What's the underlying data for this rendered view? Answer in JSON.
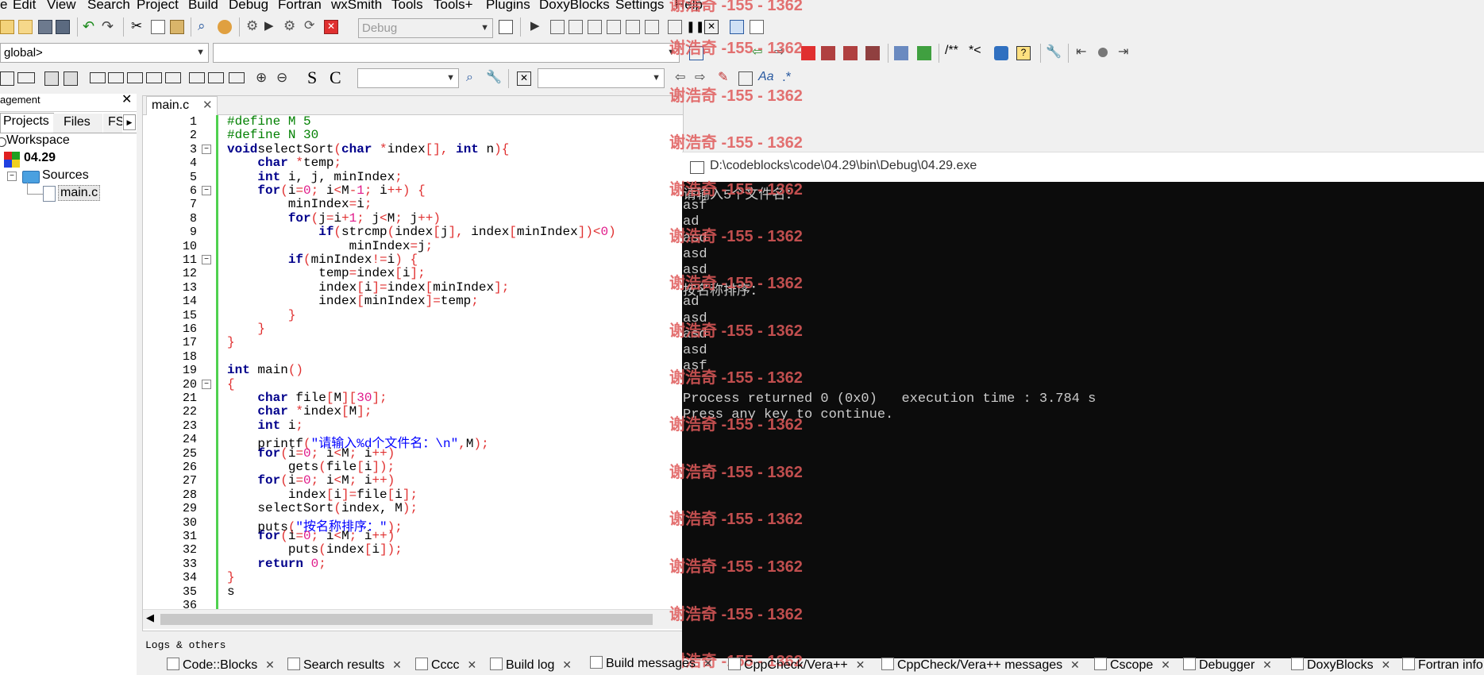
{
  "menu": [
    "e",
    "Edit",
    "View",
    "Search",
    "Project",
    "Build",
    "Debug",
    "Fortran",
    "wxSmith",
    "Tools",
    "Tools+",
    "Plugins",
    "DoxyBlocks",
    "Settings",
    "Help"
  ],
  "toolbar": {
    "build_target": "Debug",
    "scope": "global>",
    "comment_btn": "/**",
    "comment_btn2": "*<",
    "s_btn": "S",
    "c_btn": "C",
    "aa_btn": "Aa",
    "regex_btn": ".*"
  },
  "left_panel": {
    "title": "agement",
    "tabs": [
      "Projects",
      "Files",
      "FS"
    ],
    "tree": {
      "workspace": "Workspace",
      "project": "04.29",
      "folder": "Sources",
      "file": "main.c"
    }
  },
  "editor": {
    "tab": "main.c",
    "line_numbers": [
      "1",
      "2",
      "3",
      "4",
      "5",
      "6",
      "7",
      "8",
      "9",
      "10",
      "11",
      "12",
      "13",
      "14",
      "15",
      "16",
      "17",
      "18",
      "19",
      "20",
      "21",
      "22",
      "23",
      "24",
      "25",
      "26",
      "27",
      "28",
      "29",
      "30",
      "31",
      "32",
      "33",
      "34",
      "35",
      "36"
    ],
    "code": [
      [
        [
          "pp",
          "#define M 5"
        ]
      ],
      [
        [
          "pp",
          "#define N 30"
        ]
      ],
      [
        [
          "kw",
          "void"
        ],
        [
          "",
          "selectSort"
        ],
        [
          "op",
          "("
        ],
        [
          "kw",
          "char"
        ],
        [
          "",
          " "
        ],
        [
          "op",
          "*"
        ],
        [
          "",
          "index"
        ],
        [
          "op",
          "[],"
        ],
        [
          "",
          " "
        ],
        [
          "kw",
          "int"
        ],
        [
          "",
          " n"
        ],
        [
          "op",
          "){"
        ]
      ],
      [
        [
          "",
          "    "
        ],
        [
          "kw",
          "char"
        ],
        [
          "",
          " "
        ],
        [
          "op",
          "*"
        ],
        [
          "",
          "temp"
        ],
        [
          "op",
          ";"
        ]
      ],
      [
        [
          "",
          "    "
        ],
        [
          "kw",
          "int"
        ],
        [
          "",
          " i, j, minIndex"
        ],
        [
          "op",
          ";"
        ]
      ],
      [
        [
          "",
          "    "
        ],
        [
          "kw",
          "for"
        ],
        [
          "op",
          "("
        ],
        [
          "",
          "i"
        ],
        [
          "op",
          "="
        ],
        [
          "nm",
          "0"
        ],
        [
          "op",
          ";"
        ],
        [
          "",
          " i"
        ],
        [
          "op",
          "<"
        ],
        [
          "",
          "M"
        ],
        [
          "op",
          "-"
        ],
        [
          "nm",
          "1"
        ],
        [
          "op",
          ";"
        ],
        [
          "",
          " i"
        ],
        [
          "op",
          "++"
        ],
        [
          "op",
          ") {"
        ]
      ],
      [
        [
          "",
          "        minIndex"
        ],
        [
          "op",
          "="
        ],
        [
          "",
          "i"
        ],
        [
          "op",
          ";"
        ]
      ],
      [
        [
          "",
          "        "
        ],
        [
          "kw",
          "for"
        ],
        [
          "op",
          "("
        ],
        [
          "",
          "j"
        ],
        [
          "op",
          "="
        ],
        [
          "",
          "i"
        ],
        [
          "op",
          "+"
        ],
        [
          "nm",
          "1"
        ],
        [
          "op",
          ";"
        ],
        [
          "",
          " j"
        ],
        [
          "op",
          "<"
        ],
        [
          "",
          "M"
        ],
        [
          "op",
          ";"
        ],
        [
          "",
          " j"
        ],
        [
          "op",
          "++"
        ],
        [
          "op",
          ")"
        ]
      ],
      [
        [
          "",
          "            "
        ],
        [
          "kw",
          "if"
        ],
        [
          "op",
          "("
        ],
        [
          "",
          "strcmp"
        ],
        [
          "op",
          "("
        ],
        [
          "",
          "index"
        ],
        [
          "op",
          "["
        ],
        [
          "",
          "j"
        ],
        [
          "op",
          "],"
        ],
        [
          "",
          " index"
        ],
        [
          "op",
          "["
        ],
        [
          "",
          "minIndex"
        ],
        [
          "op",
          "])<"
        ],
        [
          "nm",
          "0"
        ],
        [
          "op",
          ")"
        ]
      ],
      [
        [
          "",
          "                minIndex"
        ],
        [
          "op",
          "="
        ],
        [
          "",
          "j"
        ],
        [
          "op",
          ";"
        ]
      ],
      [
        [
          "",
          "        "
        ],
        [
          "kw",
          "if"
        ],
        [
          "op",
          "("
        ],
        [
          "",
          "minIndex"
        ],
        [
          "op",
          "!="
        ],
        [
          "",
          "i"
        ],
        [
          "op",
          ") {"
        ]
      ],
      [
        [
          "",
          "            temp"
        ],
        [
          "op",
          "="
        ],
        [
          "",
          "index"
        ],
        [
          "op",
          "["
        ],
        [
          "",
          "i"
        ],
        [
          "op",
          "];"
        ]
      ],
      [
        [
          "",
          "            index"
        ],
        [
          "op",
          "["
        ],
        [
          "",
          "i"
        ],
        [
          "op",
          "]="
        ],
        [
          "",
          "index"
        ],
        [
          "op",
          "["
        ],
        [
          "",
          "minIndex"
        ],
        [
          "op",
          "];"
        ]
      ],
      [
        [
          "",
          "            index"
        ],
        [
          "op",
          "["
        ],
        [
          "",
          "minIndex"
        ],
        [
          "op",
          "]="
        ],
        [
          "",
          "temp"
        ],
        [
          "op",
          ";"
        ]
      ],
      [
        [
          "",
          "        "
        ],
        [
          "op",
          "}"
        ]
      ],
      [
        [
          "",
          "    "
        ],
        [
          "op",
          "}"
        ]
      ],
      [
        [
          "op",
          "}"
        ]
      ],
      [
        [
          "",
          ""
        ]
      ],
      [
        [
          "kw",
          "int"
        ],
        [
          "",
          " main"
        ],
        [
          "op",
          "()"
        ]
      ],
      [
        [
          "op",
          "{"
        ]
      ],
      [
        [
          "",
          "    "
        ],
        [
          "kw",
          "char"
        ],
        [
          "",
          " file"
        ],
        [
          "op",
          "["
        ],
        [
          "",
          "M"
        ],
        [
          "op",
          "]["
        ],
        [
          "nm",
          "30"
        ],
        [
          "op",
          "];"
        ]
      ],
      [
        [
          "",
          "    "
        ],
        [
          "kw",
          "char"
        ],
        [
          "",
          " "
        ],
        [
          "op",
          "*"
        ],
        [
          "",
          "index"
        ],
        [
          "op",
          "["
        ],
        [
          "",
          "M"
        ],
        [
          "op",
          "];"
        ]
      ],
      [
        [
          "",
          "    "
        ],
        [
          "kw",
          "int"
        ],
        [
          "",
          " i"
        ],
        [
          "op",
          ";"
        ]
      ],
      [
        [
          "",
          "    printf"
        ],
        [
          "op",
          "("
        ],
        [
          "st",
          "\"请输入%d个文件名：\\n\""
        ],
        [
          "op",
          ","
        ],
        [
          "",
          "M"
        ],
        [
          "op",
          ");"
        ]
      ],
      [
        [
          "",
          "    "
        ],
        [
          "kw",
          "for"
        ],
        [
          "op",
          "("
        ],
        [
          "",
          "i"
        ],
        [
          "op",
          "="
        ],
        [
          "nm",
          "0"
        ],
        [
          "op",
          ";"
        ],
        [
          "",
          " i"
        ],
        [
          "op",
          "<"
        ],
        [
          "",
          "M"
        ],
        [
          "op",
          ";"
        ],
        [
          "",
          " i"
        ],
        [
          "op",
          "++"
        ],
        [
          "op",
          ")"
        ]
      ],
      [
        [
          "",
          "        gets"
        ],
        [
          "op",
          "("
        ],
        [
          "",
          "file"
        ],
        [
          "op",
          "["
        ],
        [
          "",
          "i"
        ],
        [
          "op",
          "]);"
        ]
      ],
      [
        [
          "",
          "    "
        ],
        [
          "kw",
          "for"
        ],
        [
          "op",
          "("
        ],
        [
          "",
          "i"
        ],
        [
          "op",
          "="
        ],
        [
          "nm",
          "0"
        ],
        [
          "op",
          ";"
        ],
        [
          "",
          " i"
        ],
        [
          "op",
          "<"
        ],
        [
          "",
          "M"
        ],
        [
          "op",
          ";"
        ],
        [
          "",
          " i"
        ],
        [
          "op",
          "++"
        ],
        [
          "op",
          ")"
        ]
      ],
      [
        [
          "",
          "        index"
        ],
        [
          "op",
          "["
        ],
        [
          "",
          "i"
        ],
        [
          "op",
          "]="
        ],
        [
          "",
          "file"
        ],
        [
          "op",
          "["
        ],
        [
          "",
          "i"
        ],
        [
          "op",
          "];"
        ]
      ],
      [
        [
          "",
          "    selectSort"
        ],
        [
          "op",
          "("
        ],
        [
          "",
          "index, M"
        ],
        [
          "op",
          ");"
        ]
      ],
      [
        [
          "",
          "    puts"
        ],
        [
          "op",
          "("
        ],
        [
          "st",
          "\"按名称排序：\""
        ],
        [
          "op",
          ");"
        ]
      ],
      [
        [
          "",
          "    "
        ],
        [
          "kw",
          "for"
        ],
        [
          "op",
          "("
        ],
        [
          "",
          "i"
        ],
        [
          "op",
          "="
        ],
        [
          "nm",
          "0"
        ],
        [
          "op",
          ";"
        ],
        [
          "",
          " i"
        ],
        [
          "op",
          "<"
        ],
        [
          "",
          "M"
        ],
        [
          "op",
          ";"
        ],
        [
          "",
          " i"
        ],
        [
          "op",
          "++"
        ],
        [
          "op",
          ")"
        ]
      ],
      [
        [
          "",
          "        puts"
        ],
        [
          "op",
          "("
        ],
        [
          "",
          "index"
        ],
        [
          "op",
          "["
        ],
        [
          "",
          "i"
        ],
        [
          "op",
          "]);"
        ]
      ],
      [
        [
          "",
          "    "
        ],
        [
          "kw",
          "return"
        ],
        [
          "",
          " "
        ],
        [
          "nm",
          "0"
        ],
        [
          "op",
          ";"
        ]
      ],
      [
        [
          "op",
          "}"
        ]
      ],
      [
        [
          "",
          "s"
        ]
      ],
      [
        [
          "",
          ""
        ]
      ]
    ]
  },
  "console": {
    "title": "D:\\codeblocks\\code\\04.29\\bin\\Debug\\04.29.exe",
    "lines": [
      "请输入5个文件名：",
      "asf",
      "ad",
      "asd",
      "asd",
      "asd",
      "按名称排序：",
      "ad",
      "asd",
      "asd",
      "asd",
      "asf",
      "",
      "Process returned 0 (0x0)   execution time : 3.784 s",
      "Press any key to continue."
    ]
  },
  "watermark": "谢浩奇 -155 - 1362",
  "bottom": {
    "logs_title": "Logs & others",
    "tabs": [
      "Code::Blocks",
      "Search results",
      "Cccc",
      "Build log",
      "Build messages",
      "CppCheck/Vera++",
      "CppCheck/Vera++ messages",
      "Cscope",
      "Debugger",
      "DoxyBlocks",
      "Fortran info"
    ]
  },
  "colors": {
    "console_bg": "#0c0c0c",
    "watermark": "#e05a5a",
    "keyword": "#00008b",
    "preprocessor": "#008000"
  }
}
